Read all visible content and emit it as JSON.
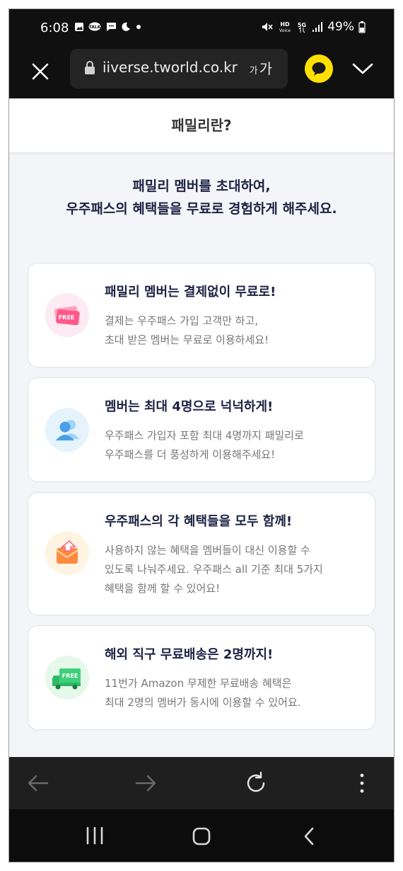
{
  "status": {
    "time": "6:08",
    "battery": "49%",
    "notif_icons": [
      "image-icon",
      "talk-icon",
      "message-icon",
      "moon-icon",
      "dot-icon"
    ],
    "right_icons": [
      "mute-icon",
      "hd-voice-icon",
      "5g-icon",
      "signal-icon",
      "battery-icon"
    ],
    "talk_label": "TALK",
    "hd_label": "HD",
    "voice_label": "Voice",
    "fiveg_label": "5G"
  },
  "browser": {
    "url": "iiverse.tworld.co.kr",
    "text_size_label": "가가",
    "text_size_small": "가",
    "text_size_large": "가"
  },
  "page": {
    "header_title": "패밀리란?",
    "intro_line1": "패밀리 멤버를 초대하여,",
    "intro_line2": "우주패스의 혜택들을 무료로 경험하게 해주세요."
  },
  "cards": [
    {
      "icon": "free-ticket-icon",
      "icon_text": "FREE",
      "title": "패밀리 멤버는 결제없이 무료로!",
      "desc": [
        "결제는 우주패스 가입 고객만 하고,",
        "초대 받은 멤버는 무료로 이용하세요!"
      ]
    },
    {
      "icon": "members-icon",
      "title": "멤버는 최대 4명으로 넉넉하게!",
      "desc": [
        "우주패스 가입자 포함 최대 4명까지 패밀리로",
        "우주패스를 더 풍성하게 이용해주세요!"
      ]
    },
    {
      "icon": "share-envelope-icon",
      "title": "우주패스의 각 혜택들을 모두 함께!",
      "desc": [
        "사용하지 않는 혜택을 멤버들이 대신 이용할 수",
        "있도록 나눠주세요. 우주패스 all 기준 최대 5가지",
        "혜택을 함께 할 수 있어요!"
      ]
    },
    {
      "icon": "free-delivery-truck-icon",
      "icon_text": "FREE",
      "title": "해외 직구 무료배송은 2명까지!",
      "desc": [
        "11번가 Amazon 무제한 무료배송 혜택은",
        "최대 2명의 멤버가 동시에 이용할 수 있어요."
      ]
    }
  ],
  "colors": {
    "page_bg": "#f4f5f8",
    "title_navy": "#1d2244",
    "kakao_yellow": "#ffe000",
    "ticket_pink": "#ff5a8a",
    "member_blue": "#4a9fe8",
    "envelope_orange": "#ff8a3d",
    "truck_green": "#3fcf7a"
  }
}
